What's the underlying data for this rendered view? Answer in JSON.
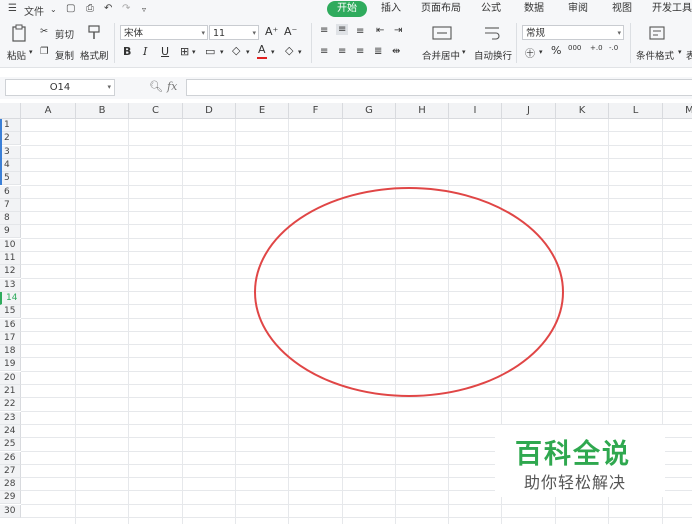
{
  "topbar": {
    "menu_label": "文件",
    "tabs": [
      "开始",
      "插入",
      "页面布局",
      "公式",
      "数据",
      "审阅",
      "视图",
      "开发工具"
    ],
    "active_tab": "开始"
  },
  "ribbon": {
    "paste": "粘贴",
    "cut": "剪切",
    "copy": "复制",
    "format_painter": "格式刷",
    "font_name": "宋体",
    "font_size": "11",
    "bold": "B",
    "italic": "I",
    "underline": "U",
    "merge_center": "合并居中",
    "wrap_text": "自动换行",
    "number_format": "常规",
    "percent": "%",
    "thousands": "000",
    "increase_decimal": "+.0",
    "decrease_decimal": "-.0",
    "conditional_format": "条件格式",
    "table_style": "表"
  },
  "formula_bar": {
    "cell_ref": "O14",
    "fx": "fx",
    "value": ""
  },
  "sheet": {
    "columns": [
      "A",
      "B",
      "C",
      "D",
      "E",
      "F",
      "G",
      "H",
      "I",
      "J",
      "K",
      "L",
      "M"
    ],
    "rows": [
      "1",
      "2",
      "3",
      "4",
      "5",
      "6",
      "7",
      "8",
      "9",
      "10",
      "11",
      "12",
      "13",
      "14",
      "15",
      "16",
      "17",
      "18",
      "19",
      "20",
      "21",
      "22",
      "23",
      "24",
      "25",
      "26",
      "27",
      "28",
      "29",
      "30"
    ],
    "active_row": "14",
    "shape": "ellipse",
    "shape_color": "#e04646"
  },
  "watermark": {
    "title": "百科全说",
    "subtitle": "助你轻松解决",
    "title_color": "#2fa84f"
  },
  "colors": {
    "accent": "#2fab5d",
    "font_color_bar": "#e02020"
  }
}
